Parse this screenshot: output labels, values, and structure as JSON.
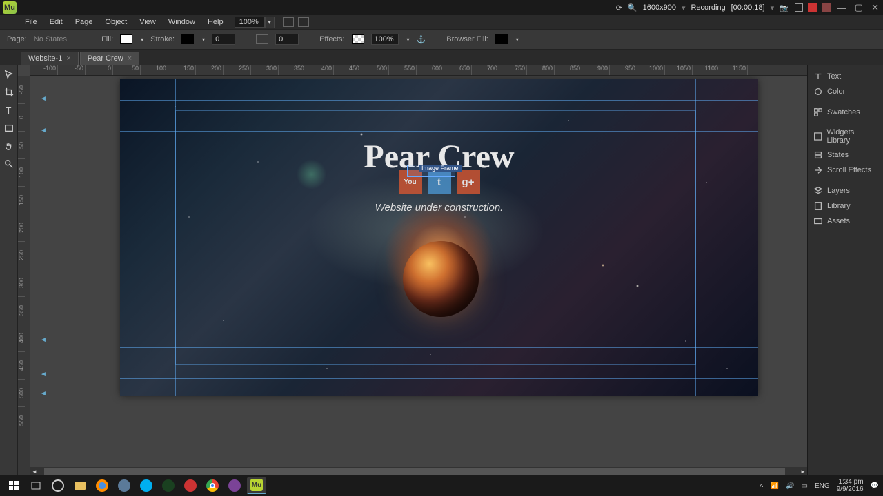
{
  "app": {
    "logo_text": "Mu"
  },
  "titlebar": {
    "resolution": "1600x900",
    "recording": "Recording",
    "rec_time": "[00:00.18]"
  },
  "menu": {
    "items": [
      "File",
      "Edit",
      "Page",
      "Object",
      "View",
      "Window",
      "Help"
    ],
    "zoom": "100%"
  },
  "optbar": {
    "page_label": "Page:",
    "page_val": "No States",
    "fill_label": "Fill:",
    "stroke_label": "Stroke:",
    "stroke_val": "0",
    "corner_val": "0",
    "effects_label": "Effects:",
    "opacity": "100%",
    "browser_fill": "Browser Fill:"
  },
  "tabs": [
    {
      "label": "Website-1"
    },
    {
      "label": "Pear Crew"
    }
  ],
  "ruler_h": [
    "-100",
    "-50",
    "0",
    "50",
    "100",
    "150",
    "200",
    "250",
    "300",
    "350",
    "400",
    "450",
    "500",
    "550",
    "600",
    "650",
    "700",
    "750",
    "800",
    "850",
    "900",
    "950",
    "1000",
    "1050",
    "1100",
    "1150"
  ],
  "ruler_v": [
    "-50",
    "0",
    "50",
    "100",
    "150",
    "200",
    "250",
    "300",
    "350",
    "400",
    "450",
    "500",
    "550"
  ],
  "canvas": {
    "title": "Pear Crew",
    "subtitle": "Website under construction.",
    "selection_label": "Image Frame",
    "social": [
      "You",
      "t",
      "g+"
    ]
  },
  "panels": [
    "Text",
    "Color",
    "Swatches",
    "Widgets Library",
    "States",
    "Scroll Effects",
    "Layers",
    "Library",
    "Assets"
  ],
  "tray": {
    "lang": "ENG",
    "time": "1:34 pm",
    "date": "9/9/2016"
  }
}
